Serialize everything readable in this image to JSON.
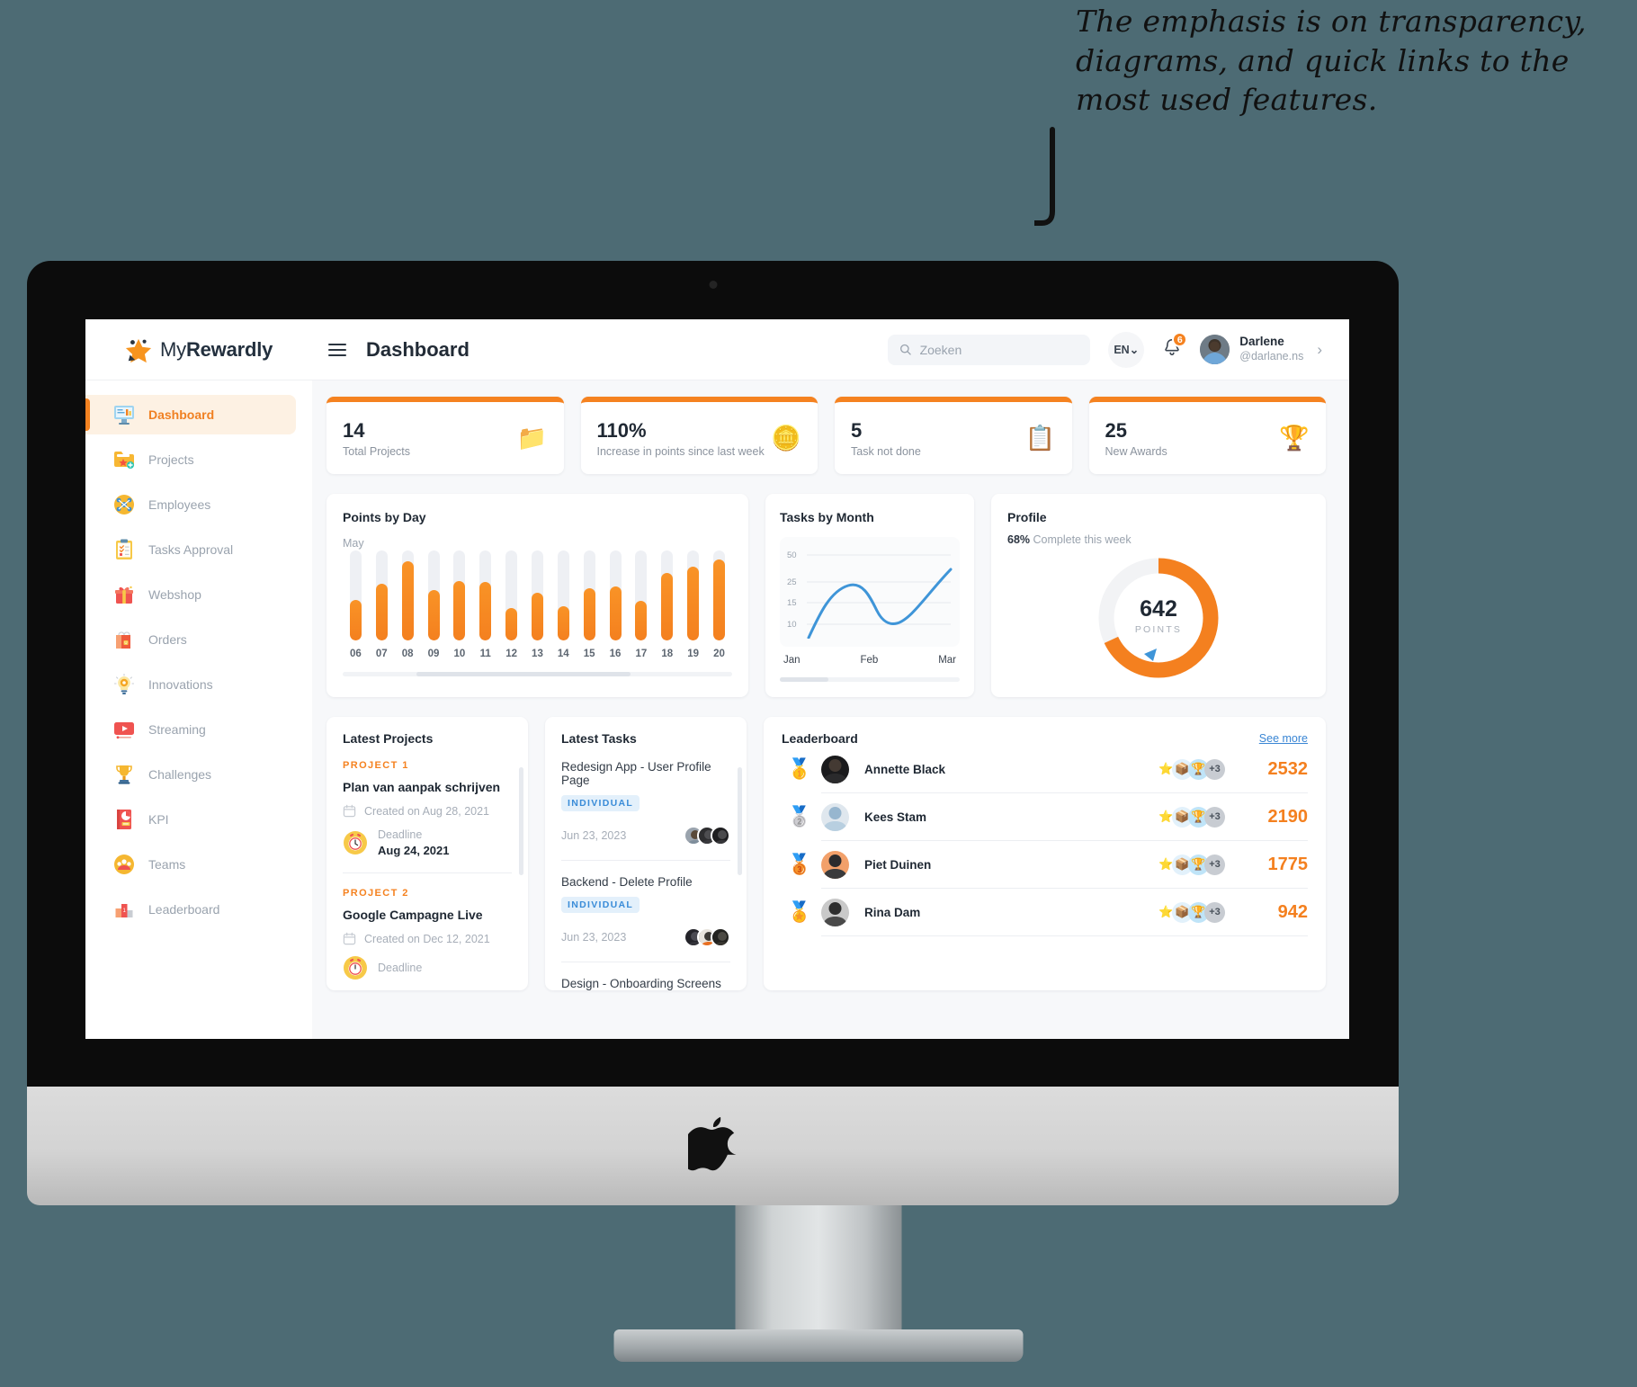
{
  "annotation": {
    "text": "The emphasis is on transparency, diagrams, and quick links to the most used features."
  },
  "app": {
    "brand_prefix": "My",
    "brand_suffix": "Rewardly",
    "page_title": "Dashboard",
    "menu_icon": "hamburger-icon"
  },
  "search": {
    "placeholder": "Zoeken",
    "value": "",
    "icon": "search-icon"
  },
  "header": {
    "language": "EN",
    "language_chevron": "⌄",
    "notifications_count": "6",
    "bell_icon": "bell-icon",
    "user_name": "Darlene",
    "user_handle": "@darlane.ns",
    "user_chevron": "›"
  },
  "sidebar": {
    "items": [
      {
        "label": "Dashboard",
        "icon": "monitor-chart-icon",
        "active": true
      },
      {
        "label": "Projects",
        "icon": "folder-star-icon",
        "active": false
      },
      {
        "label": "Employees",
        "icon": "people-network-icon",
        "active": false
      },
      {
        "label": "Tasks Approval",
        "icon": "clipboard-check-icon",
        "active": false
      },
      {
        "label": "Webshop",
        "icon": "gift-icon",
        "active": false
      },
      {
        "label": "Orders",
        "icon": "shopping-bag-icon",
        "active": false
      },
      {
        "label": "Innovations",
        "icon": "lightbulb-gear-icon",
        "active": false
      },
      {
        "label": "Streaming",
        "icon": "video-play-icon",
        "active": false
      },
      {
        "label": "Challenges",
        "icon": "trophy-icon",
        "active": false
      },
      {
        "label": "KPI",
        "icon": "pie-report-icon",
        "active": false
      },
      {
        "label": "Teams",
        "icon": "team-circle-icon",
        "active": false
      },
      {
        "label": "Leaderboard",
        "icon": "podium-icon",
        "active": false
      }
    ]
  },
  "stats": [
    {
      "value": "14",
      "caption": "Total Projects",
      "icon": "folder-star-icon",
      "emoji": "📁",
      "accent": "#f58220"
    },
    {
      "value": "110%",
      "caption": "Increase in points since last week",
      "icon": "coins-icon",
      "emoji": "🪙",
      "accent": "#f58220"
    },
    {
      "value": "5",
      "caption": "Task not done",
      "icon": "clipboard-check-icon",
      "emoji": "📋",
      "accent": "#f58220"
    },
    {
      "value": "25",
      "caption": "New Awards",
      "icon": "trophy-icon",
      "emoji": "🏆",
      "accent": "#f58220"
    }
  ],
  "chart_data": [
    {
      "type": "bar",
      "title": "Points by Day",
      "subtitle": "May",
      "xlabel": "",
      "ylabel": "",
      "categories": [
        "06",
        "07",
        "08",
        "09",
        "10",
        "11",
        "12",
        "13",
        "14",
        "15",
        "16",
        "17",
        "18",
        "19",
        "20"
      ],
      "values": [
        45,
        63,
        88,
        56,
        66,
        65,
        36,
        53,
        38,
        58,
        60,
        44,
        75,
        82,
        90
      ],
      "ylim": [
        0,
        100
      ],
      "grid": false,
      "legend": "none",
      "bar_color": "#f4801f",
      "track_color": "#eef0f4"
    },
    {
      "type": "line",
      "title": "Tasks by Month",
      "xlabel": "",
      "ylabel": "",
      "x": [
        "Jan",
        "Feb",
        "Mar"
      ],
      "tick_labels_y": [
        "50",
        "25",
        "15",
        "10"
      ],
      "ylim": [
        5,
        55
      ],
      "series": [
        {
          "name": "Tasks",
          "points": [
            5,
            24,
            10,
            29
          ],
          "color": "#3f95d8"
        }
      ],
      "grid": true,
      "legend": "none"
    },
    {
      "type": "pie",
      "title": "Profile",
      "subtitle_value": "68%",
      "subtitle_rest": "Complete this week",
      "center_value": "642",
      "center_label": "POINTS",
      "categories": [
        "Complete",
        "Remaining"
      ],
      "values": [
        68,
        32
      ],
      "colors": [
        "#f4801f",
        "#f0f1f4"
      ],
      "legend": "none"
    }
  ],
  "latest_projects": {
    "title": "Latest Projects",
    "calendar_icon": "calendar-icon",
    "deadline_icon": "alarm-clock-icon",
    "items": [
      {
        "tag": "PROJECT 1",
        "name": "Plan van aanpak schrijven",
        "created": "Created on Aug 28, 2021",
        "deadline_label": "Deadline",
        "deadline_value": "Aug 24, 2021"
      },
      {
        "tag": "PROJECT 2",
        "name": "Google Campagne Live",
        "created": "Created on Dec 12, 2021",
        "deadline_label": "Deadline",
        "deadline_value": ""
      }
    ]
  },
  "latest_tasks": {
    "title": "Latest Tasks",
    "items": [
      {
        "name": "Redesign App - User Profile Page",
        "chip": "INDIVIDUAL",
        "date": "Jun 23, 2023",
        "avatars": 3
      },
      {
        "name": "Backend - Delete Profile",
        "chip": "INDIVIDUAL",
        "date": "Jun 23, 2023",
        "avatars": 3
      },
      {
        "name": "Design - Onboarding Screens",
        "chip": "",
        "date": "",
        "avatars": 0
      }
    ]
  },
  "leaderboard": {
    "title": "Leaderboard",
    "see_more": "See more",
    "more_badge": "+3",
    "rows": [
      {
        "rank": "1",
        "medal": "🥇",
        "name": "Annette Black",
        "points": "2532"
      },
      {
        "rank": "2",
        "medal": "🥈",
        "name": "Kees Stam",
        "points": "2190"
      },
      {
        "rank": "3",
        "medal": "🥉",
        "name": "Piet Duinen",
        "points": "1775"
      },
      {
        "rank": "4",
        "medal": "🏅",
        "name": "Rina Dam",
        "points": "942"
      }
    ]
  },
  "theme": {
    "accent": "#f58220",
    "accent_dark": "#f4801f",
    "blue": "#3f95d8",
    "background": "#4d6b74",
    "page_bg": "#f7f8fa"
  }
}
